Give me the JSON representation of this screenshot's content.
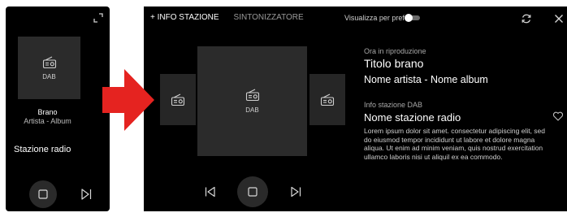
{
  "mini_player": {
    "tile_label": "DAB",
    "song_title": "Brano",
    "song_artist_album": "Artista - Album",
    "station_name": "Stazione radio"
  },
  "main_player": {
    "tabs": [
      {
        "label": "+ INFO STAZIONE",
        "active": true
      },
      {
        "label": "SINTONIZZATORE",
        "active": false
      }
    ],
    "show_favorites_label": "Visualizza per prefer",
    "show_favorites_on": false,
    "tile_label": "DAB",
    "now_playing": {
      "heading": "Ora in riproduzione",
      "title": "Titolo brano",
      "artist_album": "Nome artista - Nome album"
    },
    "station_info": {
      "heading": "Info stazione DAB",
      "name": "Nome stazione radio",
      "description": "Lorem ipsum dolor sit amet. consectetur adipiscing elit, sed do eiusmod tempor incididunt ut labore et dolore magna aliqua. Ut enim ad minim veniam, quis nostrud exercitation ullamco laboris nisi ut aliquil ex ea commodo."
    }
  },
  "colors": {
    "background": "#000000",
    "tile": "#2b2b2b",
    "arrow": "#e52320",
    "text_secondary": "#a8a8a8"
  },
  "icons": [
    "expand-icon",
    "radio-icon",
    "stop-icon",
    "skip-next-icon",
    "skip-previous-icon",
    "refresh-icon",
    "close-icon",
    "heart-icon",
    "arrow-right-icon"
  ]
}
